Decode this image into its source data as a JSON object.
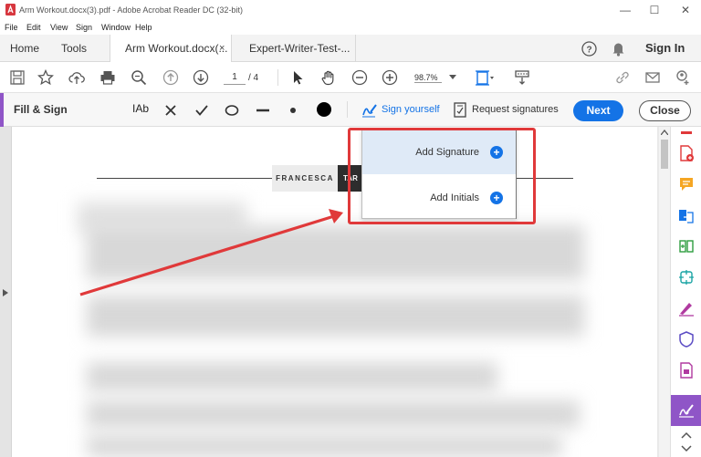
{
  "window": {
    "title": "Arm Workout.docx(3).pdf - Adobe Acrobat Reader DC (32-bit)",
    "minimize": "—",
    "maximize": "☐",
    "close": "✕"
  },
  "menu": [
    "File",
    "Edit",
    "View",
    "Sign",
    "Window",
    "Help"
  ],
  "tabs": {
    "home": "Home",
    "tools": "Tools",
    "doc1": "Arm Workout.docx(...",
    "doc1_close": "×",
    "doc2": "Expert-Writer-Test-...",
    "sign_in": "Sign In",
    "help_glyph": "?"
  },
  "toolbar": {
    "page_current": "1",
    "page_total": "/  4",
    "zoom": "98.7%"
  },
  "fill_sign": {
    "label": "Fill & Sign",
    "text_tool": "IAb",
    "sign_yourself": "Sign yourself",
    "request_signatures": "Request signatures",
    "next": "Next",
    "close": "Close"
  },
  "document": {
    "name_part1": "FRANCESCA",
    "name_part2": "TAR"
  },
  "popup": {
    "add_signature": "Add Signature",
    "add_initials": "Add Initials"
  },
  "colors": {
    "accent_purple": "#8f55c7",
    "primary_blue": "#1473e6",
    "annotation_red": "#e0393a"
  }
}
